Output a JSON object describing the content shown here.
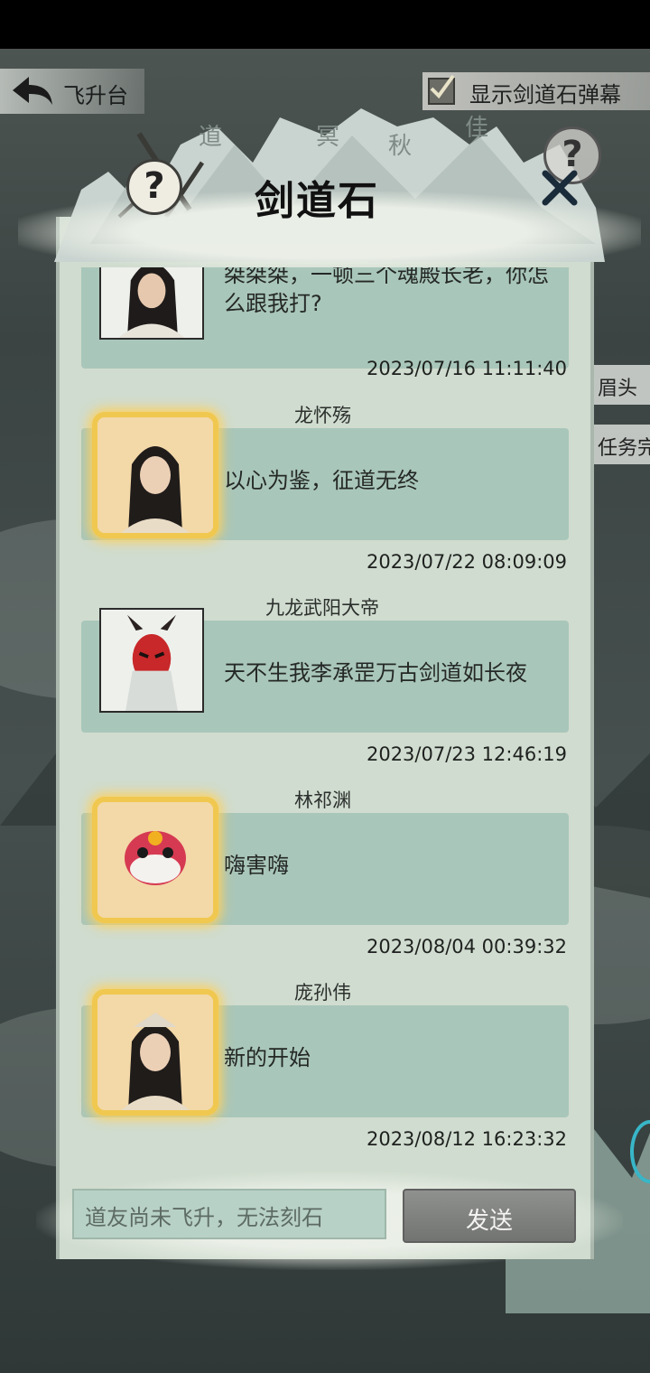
{
  "topbar": {
    "back_label": "飞升台",
    "barrage_label": "显示剑道石弹幕",
    "barrage_checked": true
  },
  "header": {
    "title": "剑道石",
    "help_symbol": "?"
  },
  "side_hints": [
    "眉头",
    "任务完"
  ],
  "messages": [
    {
      "name": "",
      "text": "桀桀桀，一顿三个魂殿长老，你怎么跟我打?",
      "time": "2023/07/16 11:11:40",
      "avatar": "male-cultivator-portrait",
      "frame": "plain"
    },
    {
      "name": "龙怀殇",
      "text": "以心为鉴，征道无终",
      "time": "2023/07/22 08:09:09",
      "avatar": "male-cultivator-portrait",
      "frame": "gold"
    },
    {
      "name": "九龙武阳大帝",
      "text": "天不生我李承罡万古剑道如长夜",
      "time": "2023/07/23 12:46:19",
      "avatar": "demon-mask-portrait",
      "frame": "plain"
    },
    {
      "name": "林祁渊",
      "text": "嗨害嗨",
      "time": "2023/08/04 00:39:32",
      "avatar": "lion-dance-portrait",
      "frame": "gold"
    },
    {
      "name": "庞孙伟",
      "text": "新的开始",
      "time": "2023/08/12 16:23:32",
      "avatar": "male-cultivator-portrait",
      "frame": "gold"
    }
  ],
  "composer": {
    "placeholder": "道友尚未飞升，无法刻石",
    "send_label": "发送"
  },
  "colors": {
    "panel": "#d0dccf",
    "bubble": "#a9c6ba",
    "gold_frame": "#f0c850",
    "send_button": "#808280"
  }
}
